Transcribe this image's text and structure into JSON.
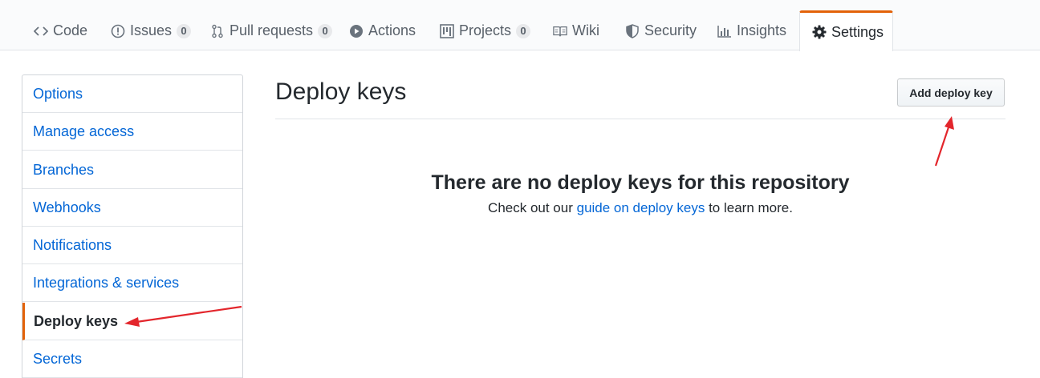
{
  "tabs": [
    {
      "label": "Code",
      "icon": "code-icon"
    },
    {
      "label": "Issues",
      "icon": "issue-icon",
      "count": "0"
    },
    {
      "label": "Pull requests",
      "icon": "pull-request-icon",
      "count": "0"
    },
    {
      "label": "Actions",
      "icon": "play-icon"
    },
    {
      "label": "Projects",
      "icon": "project-icon",
      "count": "0"
    },
    {
      "label": "Wiki",
      "icon": "book-icon"
    },
    {
      "label": "Security",
      "icon": "shield-icon"
    },
    {
      "label": "Insights",
      "icon": "graph-icon"
    },
    {
      "label": "Settings",
      "icon": "gear-icon",
      "selected": true
    }
  ],
  "sidebar": {
    "items": [
      {
        "label": "Options"
      },
      {
        "label": "Manage access"
      },
      {
        "label": "Branches"
      },
      {
        "label": "Webhooks"
      },
      {
        "label": "Notifications"
      },
      {
        "label": "Integrations & services"
      },
      {
        "label": "Deploy keys",
        "selected": true
      },
      {
        "label": "Secrets"
      }
    ]
  },
  "main": {
    "title": "Deploy keys",
    "add_button": "Add deploy key",
    "blankslate": {
      "heading": "There are no deploy keys for this repository",
      "text_before": "Check out our ",
      "link": "guide on deploy keys",
      "text_after": " to learn more."
    }
  },
  "colors": {
    "accent": "#e36209",
    "link": "#0366d6",
    "annotation": "#e3262c"
  }
}
